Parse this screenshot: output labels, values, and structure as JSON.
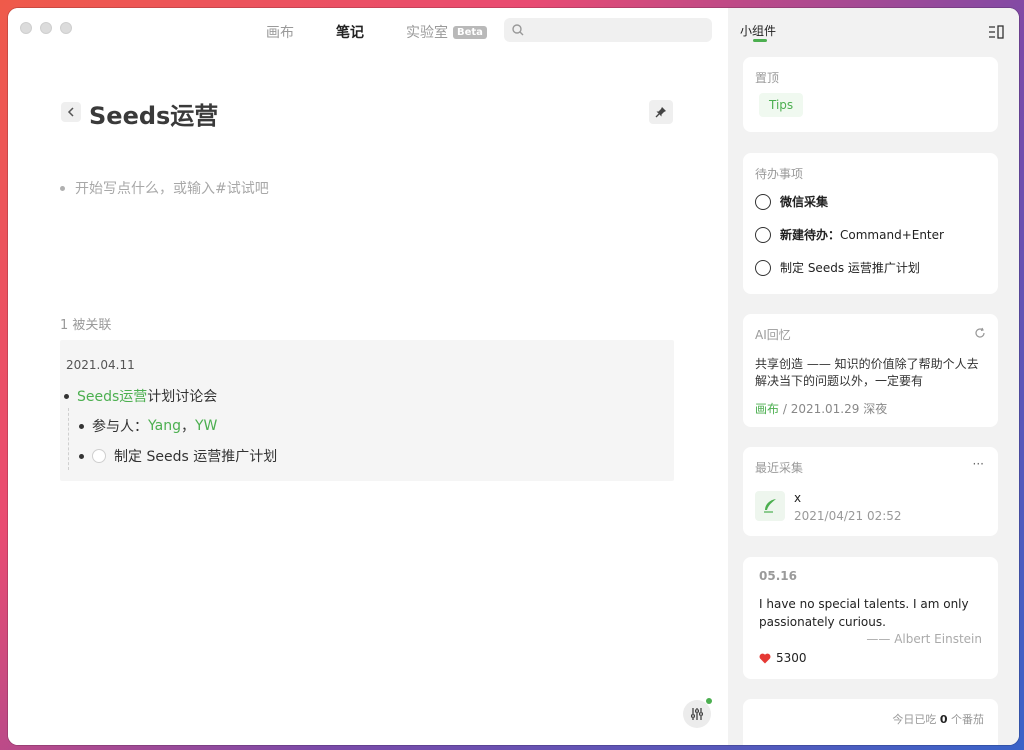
{
  "nav": {
    "tabs": [
      {
        "label": "画布"
      },
      {
        "label": "笔记"
      },
      {
        "label": "实验室",
        "badge": "Beta"
      }
    ],
    "active_tab": "笔记",
    "search_placeholder": ""
  },
  "note": {
    "title": "Seeds运营",
    "placeholder": "开始写点什么，或输入#试试吧"
  },
  "backlinks": {
    "title": "1 被关联",
    "date": "2021.04.11",
    "main_link": "Seeds运营",
    "main_text": " 计划讨论会",
    "participants_label": "参与人：",
    "participant_1": "Yang",
    "separator": "，",
    "participant_2": "YW",
    "todo_text": "制定 Seeds 运营推广计划"
  },
  "sidebar": {
    "header": "小组件",
    "pinned": {
      "title": "置顶",
      "chip": "Tips"
    },
    "todos": {
      "title": "待办事项",
      "items": [
        {
          "text": "微信采集"
        },
        {
          "bold": "新建待办：",
          "text": "Command+Enter"
        },
        {
          "text": "制定 Seeds 运营推广计划"
        }
      ]
    },
    "ai_memory": {
      "title": "AI回忆",
      "text": "共享创造 —— 知识的价值除了帮助个人去解决当下的问题以外，一定要有",
      "source_link": "画布",
      "meta": " / 2021.01.29 深夜"
    },
    "recent": {
      "title": "最近采集",
      "more": "···",
      "item_title": "x",
      "item_time": "2021/04/21 02:52"
    },
    "quote": {
      "date": "05.16",
      "text": "I have no special talents. I am only passionately curious.",
      "author": "—— Albert Einstein",
      "likes": "5300"
    },
    "tomato": {
      "prefix": "今日已吃 ",
      "count": "0",
      "suffix": " 个番茄"
    }
  },
  "colors": {
    "accent": "#4caf50",
    "sidebar_bg": "#f2f2f2",
    "heart": "#e53935"
  }
}
